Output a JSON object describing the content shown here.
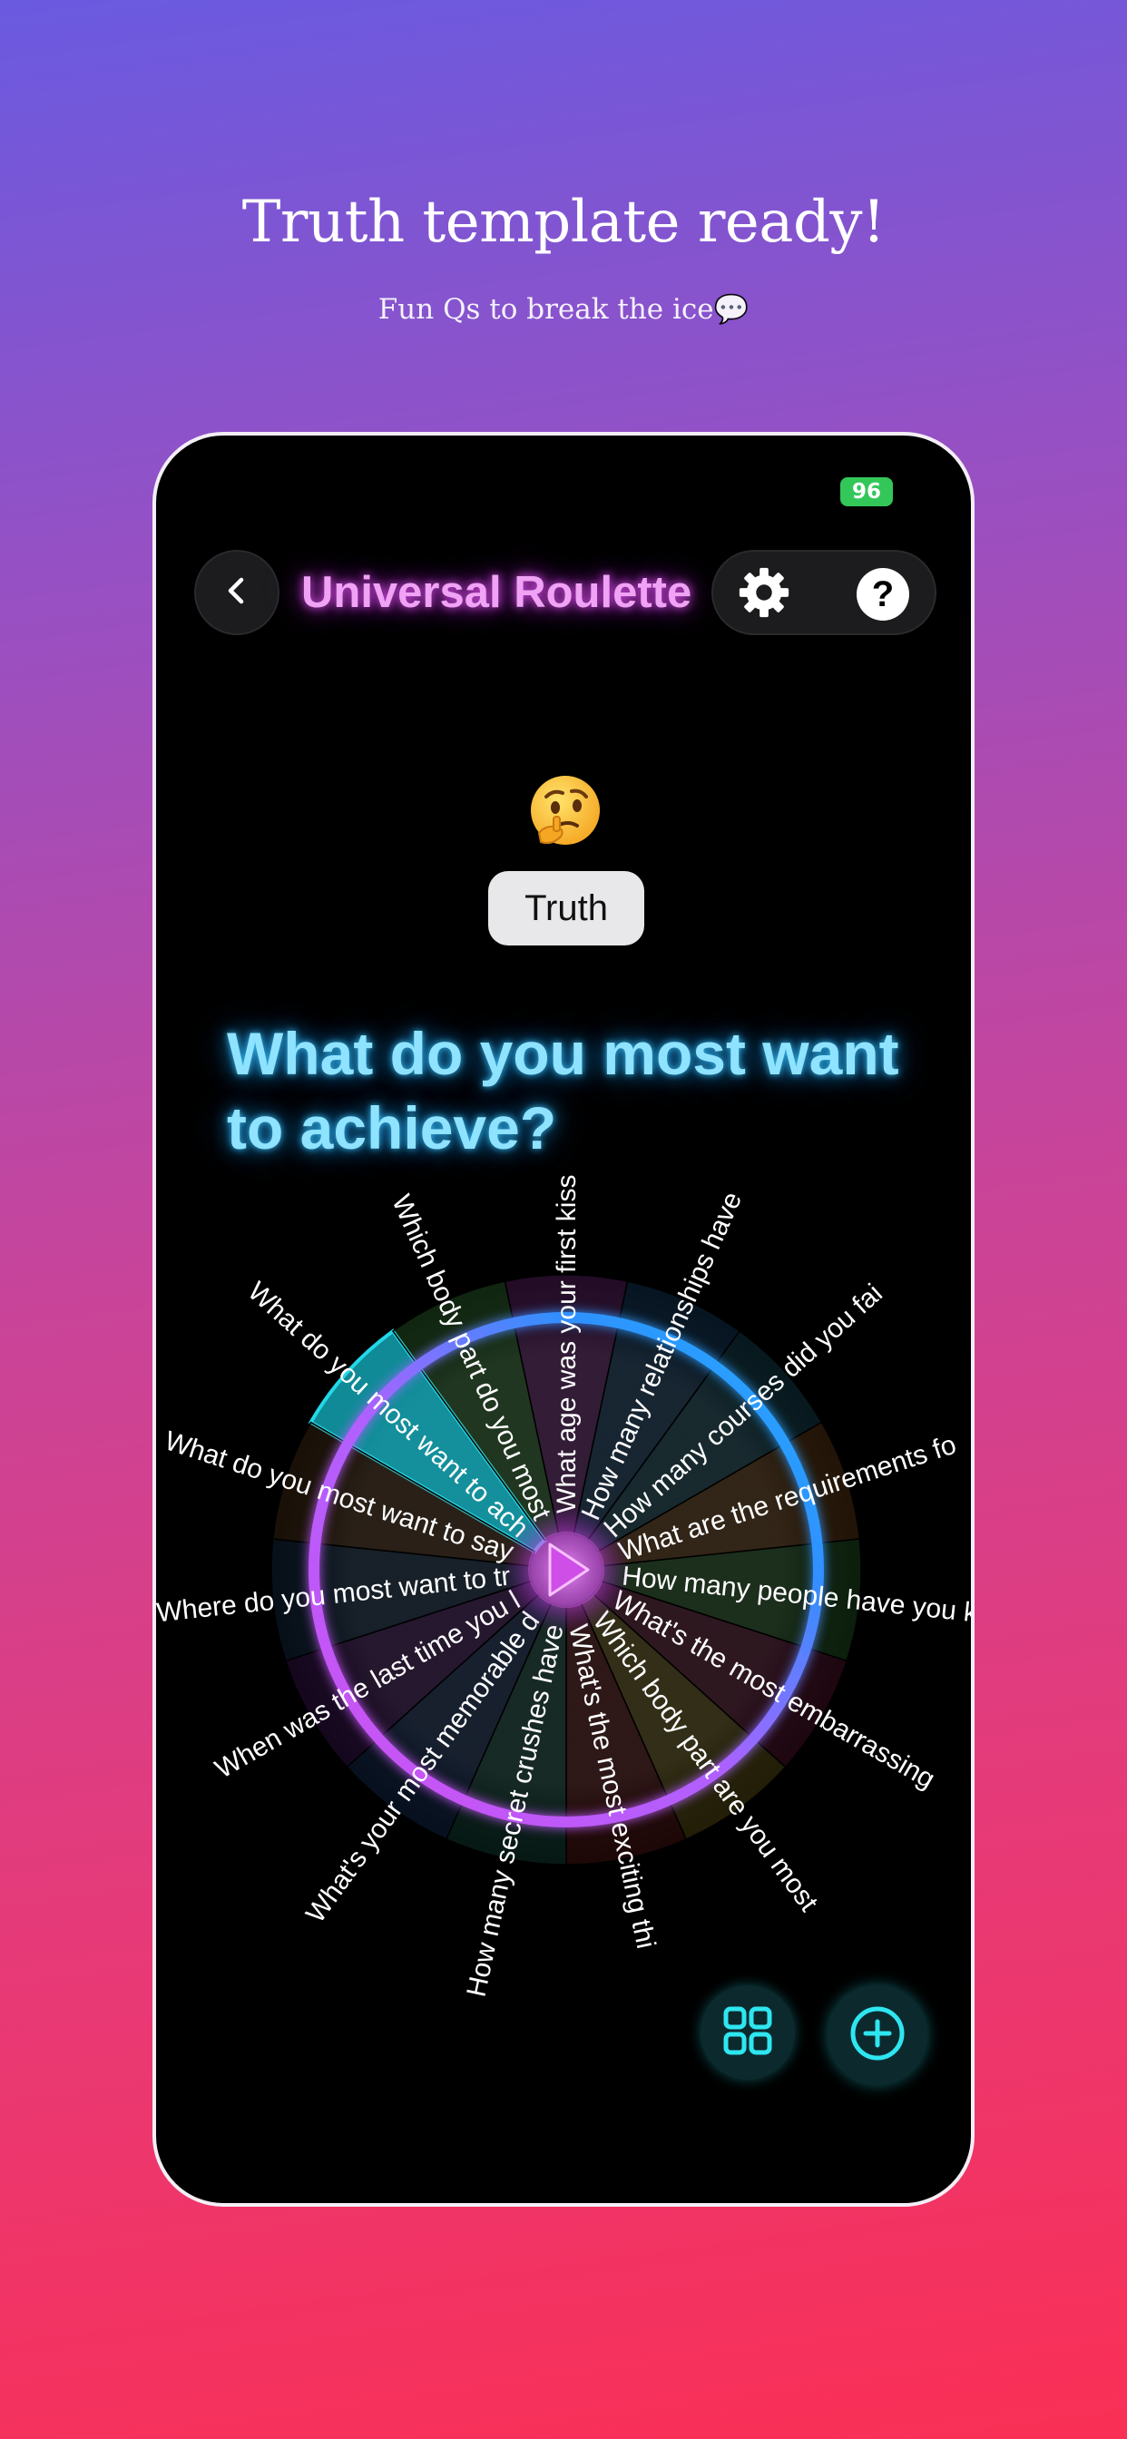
{
  "promo": {
    "headline": "Truth template ready!",
    "subline": "Fun Qs to break the ice💬"
  },
  "status_bar": {
    "battery": "96"
  },
  "header": {
    "back_icon": "chevron-left-icon",
    "title": "Universal Roulette",
    "settings_icon": "gear-icon",
    "help_label": "?"
  },
  "mode": {
    "emoji": "🤔",
    "label": "Truth"
  },
  "question": "What do you most want to achieve?",
  "wheel": {
    "selected_index": 0,
    "segments": [
      {
        "label": "What do you most want to achieve?",
        "color": "#14b8c8"
      },
      {
        "label": "Which body part do you most want to change about?",
        "color": "#3a8a3a"
      },
      {
        "label": "What age was your first kiss?",
        "color": "#7a2a8a"
      },
      {
        "label": "How many relationships have you had?",
        "color": "#1a4a7a"
      },
      {
        "label": "How many courses did you fail in college?",
        "color": "#1a5a6a"
      },
      {
        "label": "What are the requirements for a dream partner?",
        "color": "#7a4a1a"
      },
      {
        "label": "How many people have you kissed?",
        "color": "#2a6a2a"
      },
      {
        "label": "What's the most embarrassing thing you've done?",
        "color": "#6a1a3a"
      },
      {
        "label": "Which body part are you most satisfied with?",
        "color": "#7a6a1a"
      },
      {
        "label": "What's the most exciting thing you've done?",
        "color": "#6a1a1a"
      },
      {
        "label": "How many secret crushes have you had?",
        "color": "#1a5a4a"
      },
      {
        "label": "What's your most memorable date?",
        "color": "#1a3a6a"
      },
      {
        "label": "When was the last time you lied?",
        "color": "#4a1a6a"
      },
      {
        "label": "Where do you most want to travel?",
        "color": "#1a3a5a"
      },
      {
        "label": "What do you most want to say to your crush?",
        "color": "#5a3a1a"
      }
    ]
  },
  "bottom_actions": {
    "grid_icon": "grid-icon",
    "add_icon": "plus-circle-icon"
  }
}
